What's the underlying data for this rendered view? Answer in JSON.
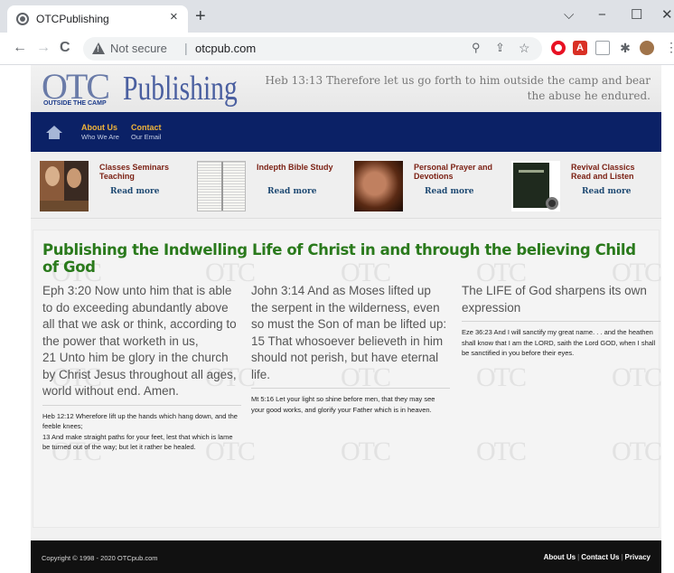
{
  "browser": {
    "tab_title": "OTCPublishing",
    "tab_close": "×",
    "new_tab": "+",
    "minimize": "⌵",
    "restore": "−",
    "maximize": "☐",
    "close": "✕",
    "back": "←",
    "forward": "→",
    "reload": "C",
    "security_label": "Not secure",
    "url_separator": "|",
    "url": "otcpub.com",
    "zoom_icon": "⚲",
    "share_icon": "⇪",
    "bookmark_icon": "☆",
    "pdf_ext_label": "A",
    "puzzle_icon": "✱",
    "menu_icon": "⋮"
  },
  "header": {
    "logo_otc": "OTC",
    "logo_subtitle": "OUTSIDE THE CAMP",
    "logo_publishing": "Publishing",
    "verse": "Heb 13:13 Therefore let us go forth to him outside the camp and bear the abuse he endured."
  },
  "navbar": {
    "items": [
      {
        "title": "About Us",
        "subtitle": "Who We Are"
      },
      {
        "title": "Contact",
        "subtitle": "Our Email"
      }
    ]
  },
  "features": [
    {
      "title": "Classes Seminars Teaching",
      "link": "Read more",
      "image": "portrait-collage"
    },
    {
      "title": "Indepth Bible Study",
      "link": "Read more",
      "image": "open-bible"
    },
    {
      "title": "Personal Prayer and Devotions",
      "link": "Read more",
      "image": "praying-person"
    },
    {
      "title": "Revival Classics Read and Listen",
      "link": "Read more",
      "image": "book-cover-and-cd"
    }
  ],
  "main": {
    "headline": "Publishing the Indwelling Life of Christ in and through the believing Child of God",
    "watermark": "OTC",
    "columns": [
      {
        "main_text": "Eph 3:20 Now unto him that is able to do exceeding abundantly above all that we ask or think, according to the power that worketh in us,\n21 Unto him be glory in the church by Christ Jesus throughout all ages, world without end. Amen.",
        "small_text": "Heb 12:12 Wherefore lift up the hands which hang down, and the feeble knees;\n13 And make straight paths for your feet, lest that which is lame be turned out of the way; but let it rather be healed."
      },
      {
        "main_text": "John 3:14 And as Moses lifted up the serpent in the wilderness, even so must the Son of man be lifted up:\n15 That whosoever believeth in him should not perish, but have eternal life.",
        "small_text": "Mt 5:16 Let your light so shine before men, that they may see your good works, and glorify your Father which is in heaven."
      },
      {
        "main_text": "The LIFE of God sharpens its own expression",
        "small_text": "Eze 36:23 And I will sanctify my great name. . .  and the heathen shall know that I am the LORD, saith the Lord GOD, when I shall be sanctified in you before their eyes."
      }
    ]
  },
  "footer": {
    "copyright": "Copyright © 1998 - 2020 OTCpub.com",
    "links": [
      "About Us",
      "Contact Us",
      "Privacy"
    ],
    "separator": "|"
  }
}
